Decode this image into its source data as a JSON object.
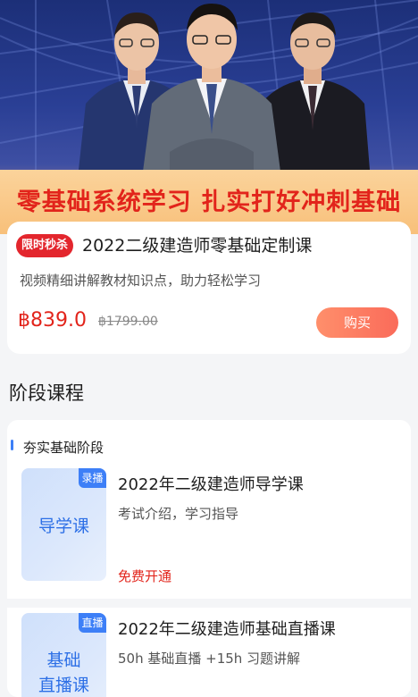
{
  "banner": {
    "slogan": "零基础系统学习 扎实打好冲刺基础",
    "colors": {
      "slogan": "#e2241b",
      "band": "#f8c07a",
      "sky": "#1c2f78"
    }
  },
  "product": {
    "badge": "限时秒杀",
    "title": "2022二级建造师零基础定制课",
    "subtitle": "视频精细讲解教材知识点，助力轻松学习",
    "price": "฿839.0",
    "original_price": "฿1799.00",
    "buy_label": "购买"
  },
  "section": {
    "title": "阶段课程"
  },
  "stage": {
    "label": "夯实基础阶段",
    "lessons": [
      {
        "tag": "录播",
        "thumb_line1": "导学课",
        "thumb_line2": "",
        "title": "2022年二级建造师导学课",
        "desc": "考试介绍，学习指导",
        "cta": "免费开通"
      },
      {
        "tag": "直播",
        "thumb_line1": "基础",
        "thumb_line2": "直播课",
        "title": "2022年二级建造师基础直播课",
        "desc": "50h 基础直播 +15h 习题讲解",
        "cta": ""
      }
    ]
  }
}
